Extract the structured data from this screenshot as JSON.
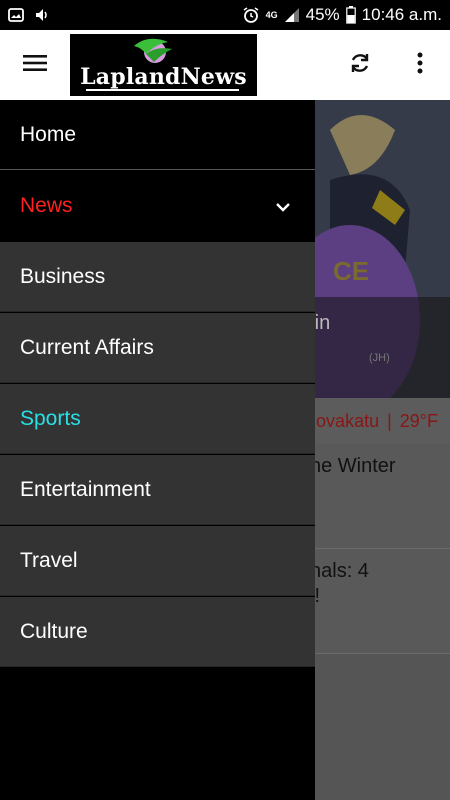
{
  "status_bar": {
    "battery": "45%",
    "time": "10:46 a.m.",
    "network": "4G"
  },
  "app_bar": {
    "logo_text": "LaplandNews"
  },
  "background": {
    "hero_caption": "e in",
    "hero_credit": "(JH)",
    "weather_city": "ovakatu",
    "weather_separator": "|",
    "weather_temp": "29°F",
    "articles": [
      {
        "line1": "he Winter",
        "line2": ""
      },
      {
        "line1": "nals: 4",
        "line2": "i!"
      }
    ]
  },
  "drawer": {
    "items": [
      {
        "label": "Home",
        "color": "#ffffff",
        "style": "dark"
      },
      {
        "label": "News",
        "color": "#ff2020",
        "style": "dark",
        "expanded_icon": "chevron-down"
      },
      {
        "label": "Business",
        "color": "#ffffff",
        "style": "sub"
      },
      {
        "label": "Current Affairs",
        "color": "#ffffff",
        "style": "sub"
      },
      {
        "label": "Sports",
        "color": "#27e0e6",
        "style": "sub"
      },
      {
        "label": "Entertainment",
        "color": "#ffffff",
        "style": "sub"
      },
      {
        "label": "Travel",
        "color": "#ffffff",
        "style": "sub"
      },
      {
        "label": "Culture",
        "color": "#ffffff",
        "style": "sub"
      }
    ]
  },
  "colors": {
    "accent_news": "#ff2020",
    "accent_sports": "#27e0e6",
    "weather_text": "#8a1515"
  }
}
